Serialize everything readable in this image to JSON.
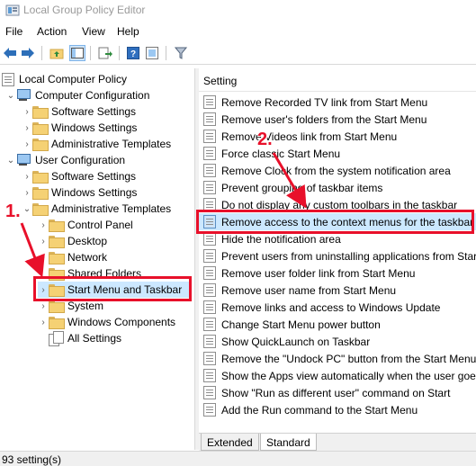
{
  "window": {
    "title": "Local Group Policy Editor"
  },
  "menu": [
    "File",
    "Action",
    "View",
    "Help"
  ],
  "toolbar": {
    "icons": [
      "back-icon",
      "forward-icon",
      "up-folder-icon",
      "show-hide-tree-icon",
      "export-list-icon",
      "help-icon",
      "properties-icon",
      "filter-icon"
    ]
  },
  "tree": {
    "items": [
      {
        "label": "Local Computer Policy"
      },
      {
        "label": "Computer Configuration"
      },
      {
        "label": "Software Settings"
      },
      {
        "label": "Windows Settings"
      },
      {
        "label": "Administrative Templates"
      },
      {
        "label": "User Configuration"
      },
      {
        "label": "Software Settings"
      },
      {
        "label": "Windows Settings"
      },
      {
        "label": "Administrative Templates"
      },
      {
        "label": "Control Panel"
      },
      {
        "label": "Desktop"
      },
      {
        "label": "Network"
      },
      {
        "label": "Shared Folders"
      },
      {
        "label": "Start Menu and Taskbar"
      },
      {
        "label": "System"
      },
      {
        "label": "Windows Components"
      },
      {
        "label": "All Settings"
      }
    ]
  },
  "list": {
    "header": "Setting",
    "rows": [
      "Remove Recorded TV link from Start Menu",
      "Remove user's folders from the Start Menu",
      "Remove Videos link from Start Menu",
      "Force classic Start Menu",
      "Remove Clock from the system notification area",
      "Prevent grouping of taskbar items",
      "Do not display any custom toolbars in the taskbar",
      "Remove access to the context menus for the taskbar",
      "Hide the notification area",
      "Prevent users from uninstalling applications from Start",
      "Remove user folder link from Start Menu",
      "Remove user name from Start Menu",
      "Remove links and access to Windows Update",
      "Change Start Menu power button",
      "Show QuickLaunch on Taskbar",
      "Remove the \"Undock PC\" button from the Start Menu",
      "Show the Apps view automatically when the user goes",
      "Show \"Run as different user\" command on Start",
      "Add the Run command to the Start Menu"
    ]
  },
  "tabs": [
    "Extended",
    "Standard"
  ],
  "status": {
    "text": "93 setting(s)"
  },
  "annotations": {
    "step1": "1.",
    "step2": "2."
  },
  "colors": {
    "highlight": "#e8102a",
    "selection": "#cce8ff"
  }
}
